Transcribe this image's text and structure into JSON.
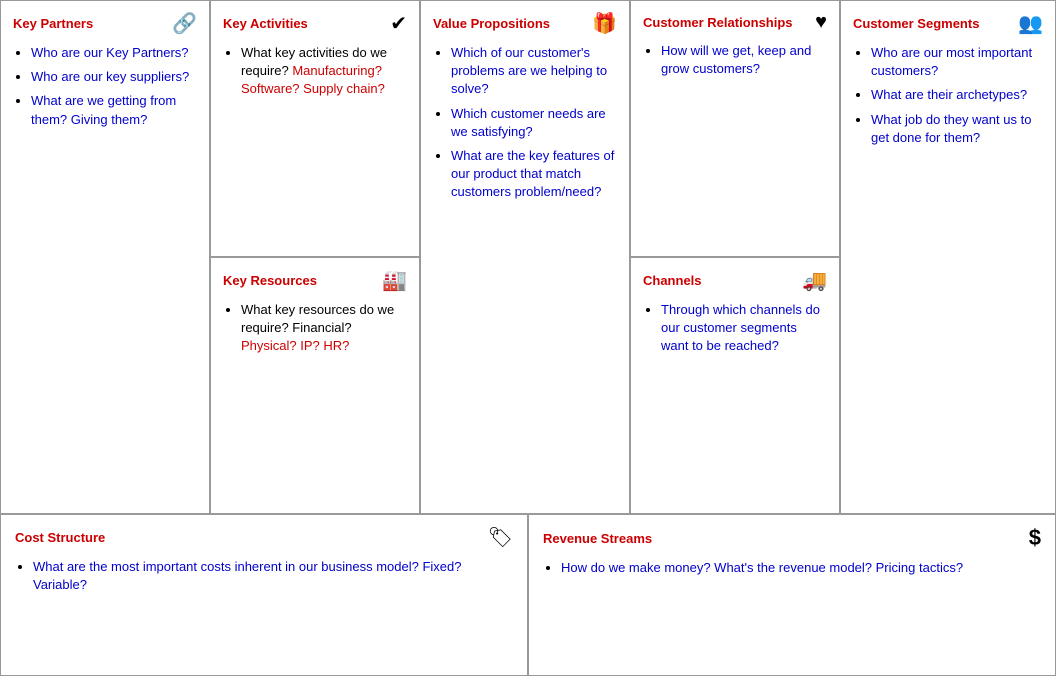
{
  "sections": {
    "key_partners": {
      "title": "Key Partners",
      "icon": "🔗",
      "items": [
        {
          "text": "Who are our Key Partners?",
          "color": "blue"
        },
        {
          "text": "Who are our key suppliers?",
          "color": "blue"
        },
        {
          "text": "What are we getting from them? Giving them?",
          "color": "blue"
        }
      ]
    },
    "key_activities": {
      "title": "Key Activities",
      "icon": "✔",
      "items": [
        {
          "text_parts": [
            {
              "text": "What key activities do we require? "
            },
            {
              "text": "Manufacturing? Software? Supply chain?",
              "color": "red"
            }
          ]
        }
      ]
    },
    "key_resources": {
      "title": "Key Resources",
      "icon": "🏭",
      "items": [
        {
          "text_parts": [
            {
              "text": "What key resources do we require? Financial? "
            },
            {
              "text": "Physical? IP? HR?",
              "color": "red"
            }
          ]
        }
      ]
    },
    "value_propositions": {
      "title": "Value Propositions",
      "icon": "🎁",
      "items": [
        {
          "text": "Which of our customer's problems are we helping to solve?",
          "color": "blue"
        },
        {
          "text": "Which customer needs are we satisfying?",
          "color": "blue"
        },
        {
          "text": "What are the key features of our product that match customers problem/need?",
          "color": "blue"
        }
      ]
    },
    "customer_relationships": {
      "title": "Customer Relationships",
      "icon": "♥",
      "items": [
        {
          "text": "How will we get, keep and grow customers?",
          "color": "blue"
        }
      ]
    },
    "channels": {
      "title": "Channels",
      "icon": "🚚",
      "items": [
        {
          "text": "Through which channels do our customer segments want to be reached?",
          "color": "blue"
        }
      ]
    },
    "customer_segments": {
      "title": "Customer Segments",
      "icon": "👥",
      "items": [
        {
          "text": "Who are our most important customers?",
          "color": "blue"
        },
        {
          "text": "What are their archetypes?",
          "color": "blue"
        },
        {
          "text": "What job do they want us to get done for them?",
          "color": "blue"
        }
      ]
    },
    "cost_structure": {
      "title": "Cost Structure",
      "icon": "🏷",
      "items": [
        {
          "text": "What are the most important costs inherent in our business model? Fixed? Variable?",
          "color": "blue"
        }
      ]
    },
    "revenue_streams": {
      "title": "Revenue Streams",
      "icon": "$",
      "items": [
        {
          "text": "How do we make money? What's the revenue model? Pricing tactics?",
          "color": "blue"
        }
      ]
    }
  }
}
